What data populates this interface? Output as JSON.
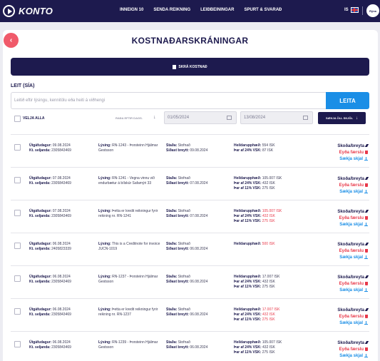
{
  "nav": {
    "brand": "KONTO",
    "links": [
      "INNEIGN 10",
      "SENDA REIKNING",
      "LEIÐBEININGAR",
      "SPURT & SVARAÐ"
    ],
    "lang": "IS",
    "avatar_text": "Rýna"
  },
  "page": {
    "back_label": "‹",
    "title": "KOSTNAÐARSKRÁNINGAR",
    "add_label": "SKRÁ KOSTNAÐ"
  },
  "search": {
    "label": "LEIT (SÍA)",
    "placeholder": "Leitið eftir lýsingu, kennitölu eða heiti á viðhengi",
    "button": "LEITA"
  },
  "filters": {
    "select_all": "VELJA ALLA",
    "sort_label": "RAÐA EFTIR DAGS.",
    "sort_icon": "↓",
    "date_from": "01/05/2024",
    "date_to": "13/08/2024",
    "download_all": "SÆKJA ÖLL SKJÖL",
    "download_icon": "↓"
  },
  "labels": {
    "issue_date": "Útgáfudagur:",
    "seller_id": "Kt. seljanda:",
    "description": "Lýsing:",
    "status": "Staða:",
    "last_changed": "Síðast breytt:",
    "total": "Heildarupphæð:",
    "vat24": "Þar af 24% VSK:",
    "vat11": "Þar af 11% VSK:",
    "view": "Skoða/breyta",
    "delete": "Eyða færslu",
    "download": "Sækja skjal"
  },
  "rows": [
    {
      "issue_date": "09.08.2024",
      "seller_id": "2305843469",
      "description": "RN-1243 - Þorsteinn Hjálmar Gestsson",
      "status": "Stofnað",
      "last_changed": "09.08.2024",
      "total": "554 ISK",
      "vat24": "87 ISK",
      "vat11": "",
      "negative": false
    },
    {
      "issue_date": "07.08.2024",
      "seller_id": "2305843469",
      "description": "RN-1241 - Vegna vinnu við endurbætur á bílskúr Safamýri 33",
      "status": "Stofnað",
      "last_changed": "07.08.2024",
      "total": "105.007 ISK",
      "vat24": "432 ISK",
      "vat11": "275 ISK",
      "negative": false
    },
    {
      "issue_date": "07.08.2024",
      "seller_id": "2305843469",
      "description": "Þetta er kredit reikningur fyrir reikning nr. RN-1241",
      "status": "Stofnað",
      "last_changed": "07.08.2024",
      "total": "105.007 ISK",
      "vat24": "432 ISK",
      "vat11": "275 ISK",
      "negative": true
    },
    {
      "issue_date": "06.08.2024",
      "seller_id": "2405823339",
      "description": "This is a Creditnote for invoice JUCN-1019",
      "status": "Stofnað",
      "last_changed": "06.08.2024",
      "total": "500 ISK",
      "vat24": "",
      "vat11": "",
      "negative": true
    },
    {
      "issue_date": "06.08.2024",
      "seller_id": "2305843469",
      "description": "RN-1237 - Þorsteinn Hjálmar Gestsson",
      "status": "Stofnað",
      "last_changed": "06.08.2024",
      "total": "17.007 ISK",
      "vat24": "432 ISK",
      "vat11": "275 ISK",
      "negative": false
    },
    {
      "issue_date": "06.08.2024",
      "seller_id": "2305843469",
      "description": "Þetta er kredit reikningur fyrir reikning nr. RN-1237",
      "status": "Stofnað",
      "last_changed": "06.08.2024",
      "total": "17.007 ISK",
      "vat24": "432 ISK",
      "vat11": "275 ISK",
      "negative": true
    },
    {
      "issue_date": "06.08.2024",
      "seller_id": "2305843469",
      "description": "RN-1239 - Þorsteinn Hjálmar Gestsson",
      "status": "Stofnað",
      "last_changed": "06.08.2024",
      "total": "105.007 ISK",
      "vat24": "432 ISK",
      "vat11": "275 ISK",
      "negative": false
    }
  ],
  "colors": {
    "navy": "#1d1a4e",
    "accent_blue": "#1a8ee6",
    "danger_red": "#e8394a",
    "back_pink": "#f05a6a"
  }
}
